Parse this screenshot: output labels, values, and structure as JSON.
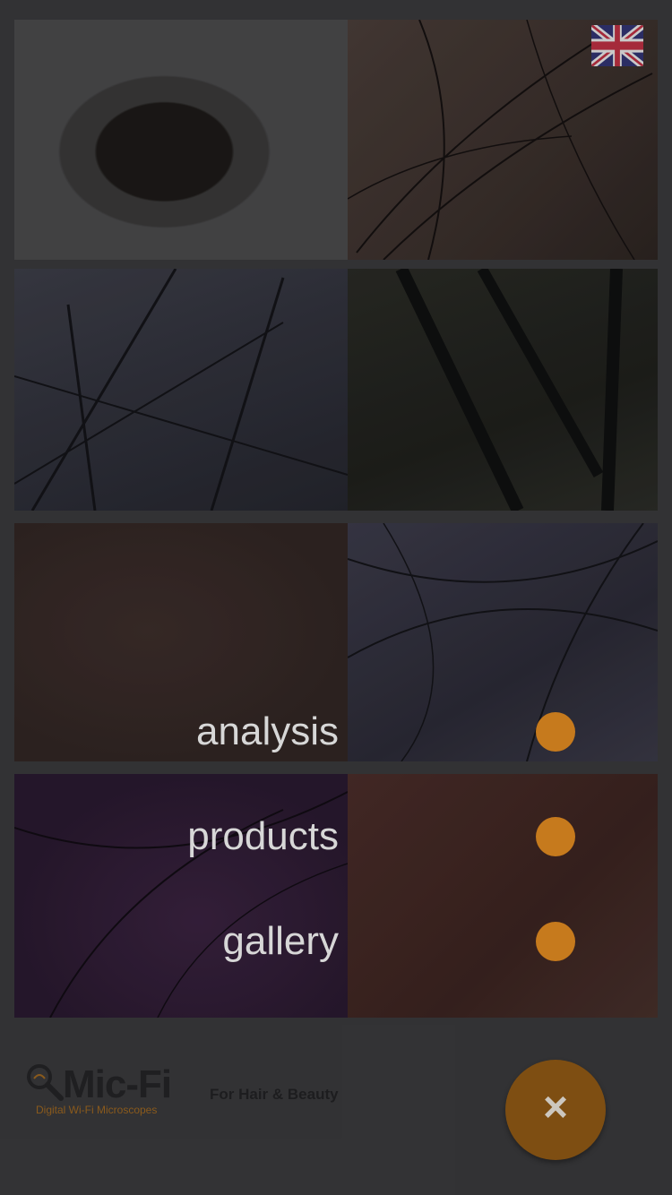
{
  "language_flag": {
    "icon": "uk-flag-icon",
    "label": "English"
  },
  "menu": {
    "items": [
      {
        "label": "analysis"
      },
      {
        "label": "products"
      },
      {
        "label": "gallery"
      }
    ],
    "dot_color": "#c67a1d"
  },
  "footer": {
    "logo_text": "Mic-Fi",
    "logo_subtitle": "Digital Wi-Fi Microscopes",
    "tagline": "For Hair & Beauty",
    "close_icon": "×"
  }
}
